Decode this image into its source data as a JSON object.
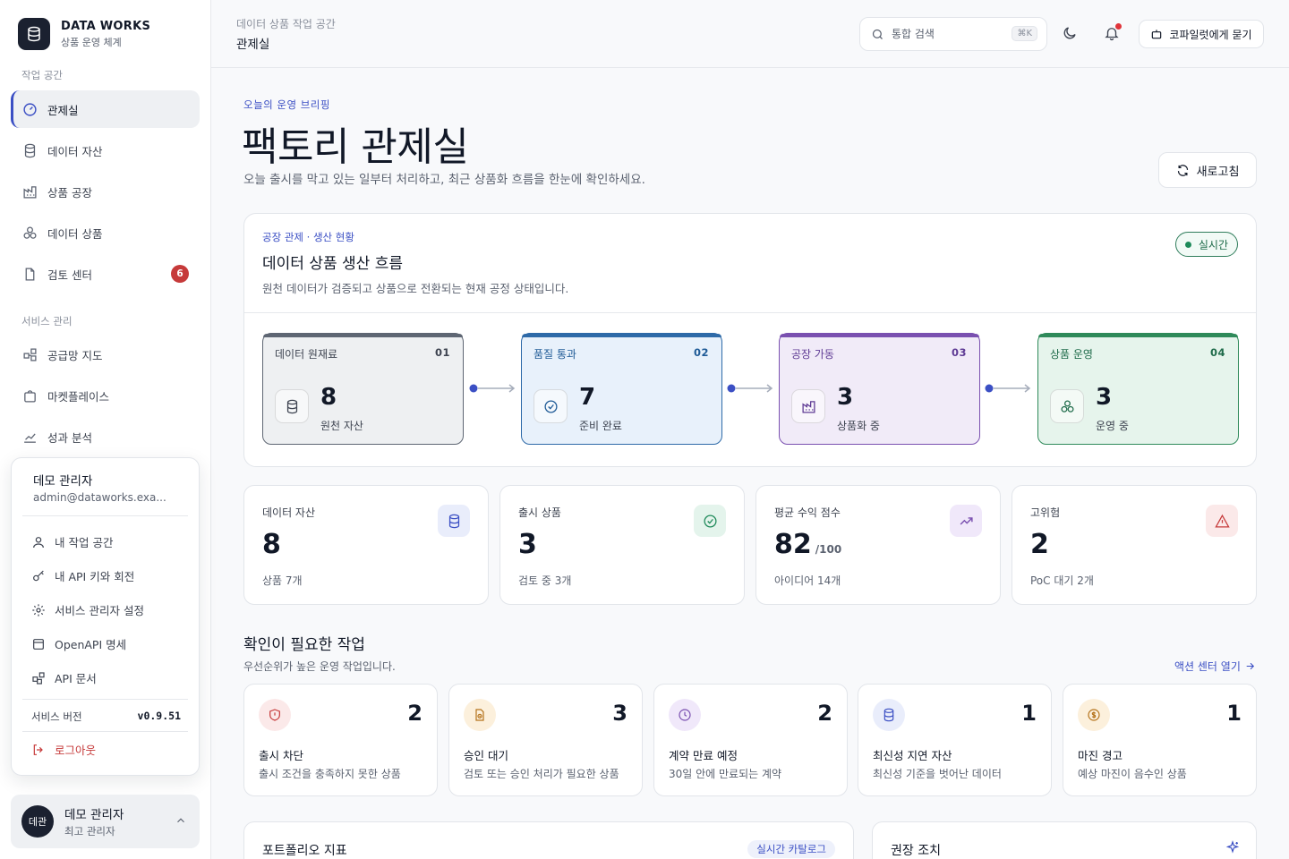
{
  "brand": {
    "name": "DATA WORKS",
    "subtitle": "상품 운영 체계"
  },
  "sidebar": {
    "section_workspace": "작업 공간",
    "section_service": "서비스 관리",
    "items": [
      {
        "label": "관제실",
        "icon": "gauge-icon",
        "active": true
      },
      {
        "label": "데이터 자산",
        "icon": "database-icon"
      },
      {
        "label": "상품 공장",
        "icon": "factory-icon"
      },
      {
        "label": "데이터 상품",
        "icon": "cubes-icon"
      },
      {
        "label": "검토 센터",
        "icon": "file-check-icon",
        "badge": "6"
      },
      {
        "label": "공급망 지도",
        "icon": "network-icon"
      },
      {
        "label": "마켓플레이스",
        "icon": "store-icon"
      },
      {
        "label": "성과 분석",
        "icon": "chart-icon"
      }
    ]
  },
  "user_menu": {
    "name": "데모 관리자",
    "email": "admin@dataworks.exa...",
    "items": [
      {
        "label": "내 작업 공간",
        "icon": "user-icon"
      },
      {
        "label": "내 API 키와 회전",
        "icon": "key-icon"
      },
      {
        "label": "서비스 관리자 설정",
        "icon": "gear-icon"
      },
      {
        "label": "OpenAPI 명세",
        "icon": "document-icon"
      },
      {
        "label": "API 문서",
        "icon": "blocks-icon"
      }
    ],
    "version_label": "서비스 버전",
    "version": "v0.9.51",
    "logout": "로그아웃"
  },
  "user_card": {
    "avatar": "데관",
    "name": "데모 관리자",
    "role": "최고 관리자"
  },
  "topbar": {
    "breadcrumb": "데이터 상품 작업 공간",
    "title": "관제실",
    "search_placeholder": "통합 검색",
    "shortcut": "⌘K",
    "ask_button": "코파일럿에게 묻기"
  },
  "hero": {
    "eyebrow": "오늘의 운영 브리핑",
    "title": "팩토리 관제실",
    "description": "오늘 출시를 막고 있는 일부터 처리하고, 최근 상품화 흐름을 한눈에 확인하세요.",
    "refresh": "새로고침"
  },
  "flow": {
    "eyebrow": "공장 관제 · 생산 현황",
    "title": "데이터 상품 생산 흐름",
    "description": "원천 데이터가 검증되고 상품으로 전환되는 현재 공정 상태입니다.",
    "live": "실시간",
    "stages": [
      {
        "label": "데이터 원재료",
        "num": "01",
        "value": "8",
        "sub": "원천 자산",
        "icon": "database-icon"
      },
      {
        "label": "품질 통과",
        "num": "02",
        "value": "7",
        "sub": "준비 완료",
        "icon": "check-circle-icon"
      },
      {
        "label": "공장 가동",
        "num": "03",
        "value": "3",
        "sub": "상품화 중",
        "icon": "factory-icon"
      },
      {
        "label": "상품 운영",
        "num": "04",
        "value": "3",
        "sub": "운영 중",
        "icon": "cubes-icon"
      }
    ]
  },
  "kpis": [
    {
      "label": "데이터 자산",
      "value": "8",
      "unit": "",
      "sub": "상품 7개",
      "icon": "database-icon"
    },
    {
      "label": "출시 상품",
      "value": "3",
      "unit": "",
      "sub": "검토 중 3개",
      "icon": "check-circle-icon"
    },
    {
      "label": "평균 수익 점수",
      "value": "82",
      "unit": "/100",
      "sub": "아이디어 14개",
      "icon": "trend-up-icon"
    },
    {
      "label": "고위험",
      "value": "2",
      "unit": "",
      "sub": "PoC 대기 2개",
      "icon": "warning-icon"
    }
  ],
  "tasks_section": {
    "title": "확인이 필요한 작업",
    "description": "우선순위가 높은 운영 작업입니다.",
    "link": "액션 센터 열기"
  },
  "tasks": [
    {
      "count": "2",
      "title": "출시 차단",
      "desc": "출시 조건을 충족하지 못한 상품",
      "icon": "shield-alert-icon"
    },
    {
      "count": "3",
      "title": "승인 대기",
      "desc": "검토 또는 승인 처리가 필요한 상품",
      "icon": "file-clock-icon"
    },
    {
      "count": "2",
      "title": "계약 만료 예정",
      "desc": "30일 안에 만료되는 계약",
      "icon": "clock-icon"
    },
    {
      "count": "1",
      "title": "최신성 지연 자산",
      "desc": "최신성 기준을 벗어난 데이터",
      "icon": "database-icon"
    },
    {
      "count": "1",
      "title": "마진 경고",
      "desc": "예상 마진이 음수인 상품",
      "icon": "coin-icon"
    }
  ],
  "bottom": {
    "portfolio_title": "포트폴리오 지표",
    "portfolio_badge": "실시간 카탈로그",
    "actions_title": "권장 조치"
  }
}
